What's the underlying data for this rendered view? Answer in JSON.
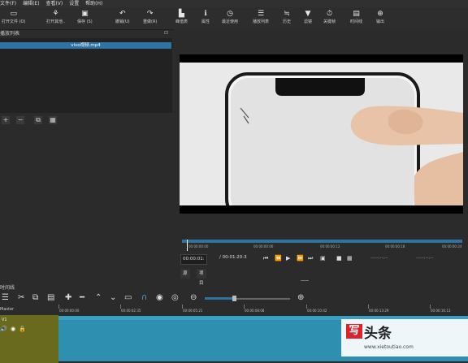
{
  "menubar": [
    "文件(F)",
    "编辑(E)",
    "查看(V)",
    "设置",
    "帮助(H)"
  ],
  "toolbar": {
    "open_file": "打开文件 (O)",
    "open_other": "打开其他..",
    "save": "保存 (S)",
    "undo": "撤销(U)",
    "redo": "重做(R)",
    "peak": "峰值表",
    "properties": "属性",
    "recent": "最近使用",
    "playlist": "播放列表",
    "history": "历史",
    "filters": "滤镜",
    "keyframes": "关键帧",
    "timeline": "时间线",
    "export": "输出"
  },
  "playlist": {
    "title": "播放列表",
    "item": "vivo视频.mp4"
  },
  "player": {
    "ruler_ticks": [
      "00:00:00:00",
      "00:00:00:06",
      "00:00:00:12",
      "00:00:00:18",
      "00:00:00:24"
    ],
    "position": "00:00:01:",
    "duration": "/ 00:01:20:3",
    "in_point": "--:--:--:--",
    "out_point": "--:--:--:--",
    "tab_source": "源",
    "tab_project": "项目"
  },
  "timeline": {
    "title": "时间线",
    "master_label": "Master",
    "track_label": "V1",
    "ruler": [
      "00:00:00:00",
      "00:00:02:35",
      "00:00:05:21",
      "00:00:08:08",
      "00:00:10:42",
      "00:00:13:29",
      "00:00:16:13"
    ],
    "zoom_level": 0.3
  },
  "watermark": {
    "title": "头条",
    "url": "www.xietoutiao.com"
  }
}
